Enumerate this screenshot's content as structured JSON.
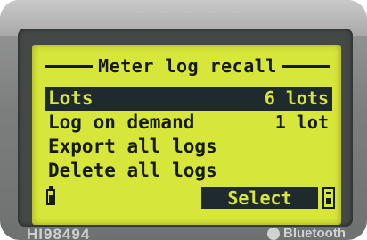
{
  "screen": {
    "title": "Meter log recall",
    "menu": [
      {
        "label": "Lots",
        "value": "6 lots",
        "selected": true
      },
      {
        "label": "Log on demand",
        "value": "1 lot",
        "selected": false
      },
      {
        "label": "Export all logs",
        "value": "",
        "selected": false
      },
      {
        "label": "Delete all logs",
        "value": "",
        "selected": false
      }
    ],
    "softkey": {
      "select_label": "Select"
    }
  },
  "device": {
    "model_label": "HI98494",
    "brand_label": "Bluetooth"
  },
  "icons": {
    "battery": "battery-icon",
    "aux": "aux-status-icon",
    "bluetooth": "bluetooth-icon"
  },
  "colors": {
    "lcd_background": "#d7e63a",
    "lcd_text": "#161a10",
    "highlight": "#1f2a2e",
    "housing": "#7d7f7e"
  }
}
